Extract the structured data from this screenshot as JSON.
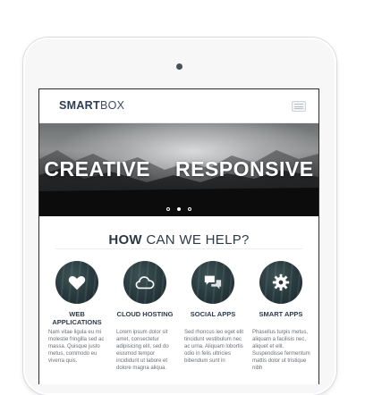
{
  "header": {
    "logo_bold": "SMART",
    "logo_light": "BOX",
    "menu_icon": "hamburger-menu-icon"
  },
  "hero": {
    "word1": "CREATIVE",
    "word2": "RESPONSIVE",
    "slides": 3,
    "active_slide": 2
  },
  "section": {
    "title_bold": "HOW",
    "title_rest": " CAN WE HELP?"
  },
  "services": [
    {
      "icon": "heart-icon",
      "title": "WEB APPLICATIONS",
      "text": "Nam vitae ligula eu mi molestie fringilla sed ac massa. Quisque justo metus, commodo eu viverra quis."
    },
    {
      "icon": "cloud-icon",
      "title": "CLOUD HOSTING",
      "text": "Lorem ipsum dolor sit amet, consectetur adipisicing elit, sed do eiusmod tempor incididunt ut labore et dolore magna aliqua."
    },
    {
      "icon": "chat-bubbles-icon",
      "title": "SOCIAL APPS",
      "text": "Sed rhoncus leo eget elit tincidunt vestibulum nec ac urna. Aliquam lobortis odio in felis ultricies bibendum sunt in"
    },
    {
      "icon": "gear-icon",
      "title": "SMART APPS",
      "text": "Phasellus turpis metus, aliquam a facilisis nec, aliquet et elit. Suspendisse fermentum mattis dolor ut tristique nibh"
    }
  ]
}
